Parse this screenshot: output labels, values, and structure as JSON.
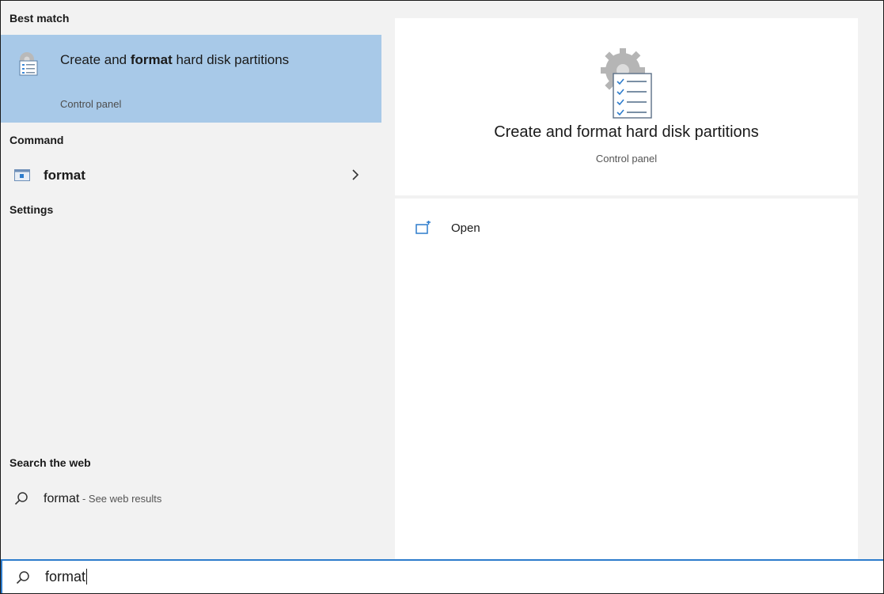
{
  "sections": {
    "best_match": "Best match",
    "command": "Command",
    "settings": "Settings",
    "search_web": "Search the web"
  },
  "best_match_item": {
    "title_before": "Create and ",
    "title_bold": "format",
    "title_after": " hard disk partitions",
    "subtitle": "Control panel",
    "icon": "disk-management-icon"
  },
  "command_item": {
    "label": "format",
    "icon": "command-window-icon"
  },
  "web_item": {
    "query": "format",
    "suffix": " - See web results",
    "icon": "search-icon"
  },
  "preview": {
    "title": "Create and format hard disk partitions",
    "subtitle": "Control panel",
    "icon": "disk-management-icon"
  },
  "actions": [
    {
      "label": "Open",
      "icon": "open-window-icon"
    }
  ],
  "search_bar": {
    "value": "format",
    "icon": "search-icon"
  },
  "colors": {
    "selection": "#a8c9e8",
    "accent": "#2d7ccc",
    "panel": "#f2f2f2"
  }
}
